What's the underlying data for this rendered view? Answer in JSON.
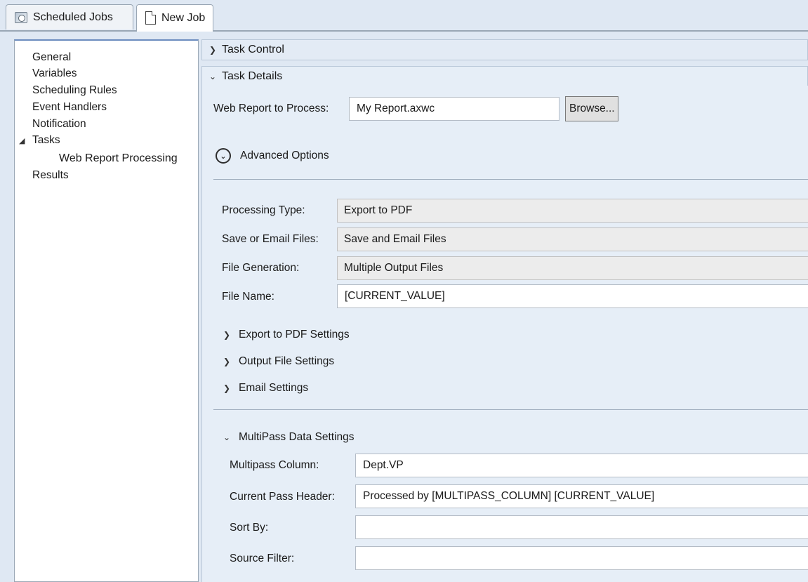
{
  "tabs": [
    {
      "label": "Scheduled Jobs",
      "icon": "scheduled-jobs-icon"
    },
    {
      "label": "New Job",
      "icon": "document-icon"
    }
  ],
  "nav": {
    "items": [
      {
        "label": "General"
      },
      {
        "label": "Variables"
      },
      {
        "label": "Scheduling Rules"
      },
      {
        "label": "Event Handlers"
      },
      {
        "label": "Notification"
      },
      {
        "label": "Tasks",
        "expanded": true
      },
      {
        "label": "Web Report Processing"
      },
      {
        "label": "Results"
      }
    ]
  },
  "sections": {
    "task_control": {
      "label": "Task Control",
      "expanded": false
    },
    "task_details": {
      "label": "Task Details",
      "expanded": true
    }
  },
  "details": {
    "web_report_label": "Web Report to Process:",
    "web_report_value": "My Report.axwc",
    "browse_label": "Browse...",
    "advanced_options_label": "Advanced Options",
    "processing_type_label": "Processing Type:",
    "processing_type_value": "Export to PDF",
    "save_email_label": "Save or Email Files:",
    "save_email_value": "Save and Email Files",
    "file_generation_label": "File Generation:",
    "file_generation_value": "Multiple Output Files",
    "file_name_label": "File Name:",
    "file_name_value": "[CURRENT_VALUE]",
    "export_pdf_settings_label": "Export to PDF Settings",
    "output_file_settings_label": "Output File Settings",
    "email_settings_label": "Email Settings"
  },
  "multipass": {
    "header": "MultiPass Data Settings",
    "column_label": "Multipass Column:",
    "column_value": "Dept.VP",
    "header_label": "Current Pass Header:",
    "header_value": "Processed by [MULTIPASS_COLUMN] [CURRENT_VALUE]",
    "sort_label": "Sort By:",
    "sort_value": "",
    "filter_label": "Source Filter:",
    "filter_value": ""
  }
}
